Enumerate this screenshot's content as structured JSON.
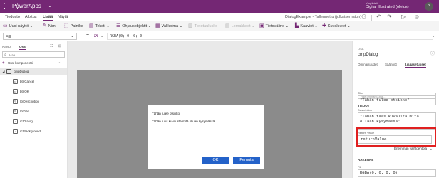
{
  "titlebar": {
    "app_title": "PowerApps",
    "grid_icon": "waffle-grid-icon",
    "env_label": "Ympäristö",
    "env_name": "Digital Illustrated (oletus)",
    "user_initials": "PI"
  },
  "menu": {
    "tabs": [
      "Tiedosto",
      "Aloitus",
      "Lisää",
      "Näytä"
    ],
    "active_tab": "Lisää",
    "saved_text": "DialogExample - Tallennettu (julkaisematon)"
  },
  "ribbon": {
    "new_screen": "Uusi näyttö",
    "label": "Nimi",
    "button": "Painike",
    "text": "Teksti",
    "controls": "Ohjausobjektit",
    "gallery": "Valikoima",
    "data_table": "Tietotaulukko",
    "forms": "Lomakkeet",
    "media": "Tietoväline",
    "charts": "Kaaviot",
    "icons": "Kuvakkeet"
  },
  "formula": {
    "property": "Fill",
    "fx": "fx",
    "value": "RGBA(0; 0; 0; 0)"
  },
  "tree": {
    "tab_tree": "Näytöt",
    "tab_components": "Osat",
    "search_placeholder": "Hae",
    "new_component": "Uusi komponentti",
    "component": "cmpDialog",
    "items": [
      "btnCancel",
      "btnOK",
      "lblDescription",
      "lblTitle",
      "rctDialog",
      "rctBackground"
    ]
  },
  "dialog": {
    "title": "Tähän tulee otsikko",
    "description": "Tähän tuus kuvausta mitä olluan kysymässä",
    "ok": "OK",
    "cancel": "Peruuta"
  },
  "properties": {
    "type_label": "OSA",
    "name": "cmpDialog",
    "tabs": [
      "Ominaisuudet",
      "Lisäasetukset",
      "Lisäasetukset"
    ],
    "tab_labels": [
      "Ominaisuudet",
      "Säännöt",
      "Lisäasetukset"
    ],
    "active_tab": "Lisäasetukset",
    "search_placeholder": "Hae ominaisuutta...",
    "section_data": "TIEDOT",
    "title_label": "Title",
    "title_value": "\"Tähän tulee otsikko\"",
    "desc_label": "Description",
    "desc_value": "\"Tähän taas kuvausta mitä ollaan kysymässä\"",
    "return_label": "Return Value",
    "return_value": "returnValue",
    "more_options": "Enemmän vaihtoehtoja",
    "section_design": "RAKENNE",
    "fill_label": "Fill",
    "fill_value": "RGBA(0; 0; 0; 0)"
  },
  "colors": {
    "brand": "#742774",
    "highlight": "#e02020",
    "button_blue": "#2462c9"
  }
}
